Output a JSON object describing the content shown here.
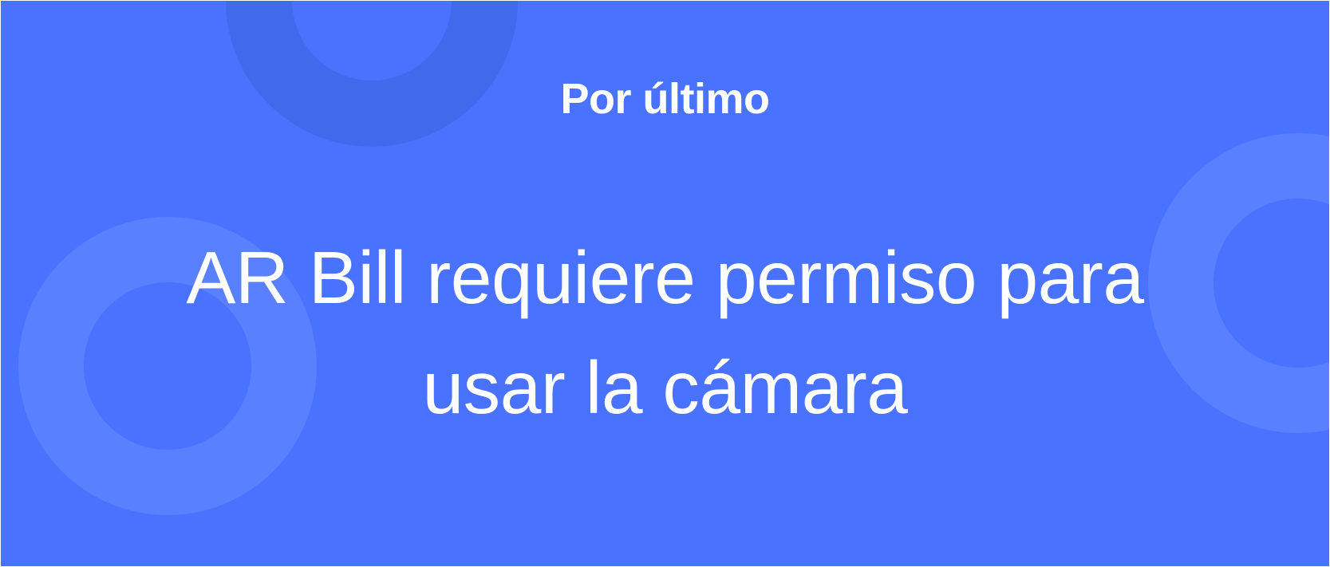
{
  "onboarding": {
    "eyebrow": "Por último",
    "headline": "AR Bill requiere permiso para usar la cámara"
  },
  "colors": {
    "background": "#4872ff",
    "text": "#ffffff",
    "ring_dark": "#3f6aec",
    "ring_light": "#5880ff"
  }
}
